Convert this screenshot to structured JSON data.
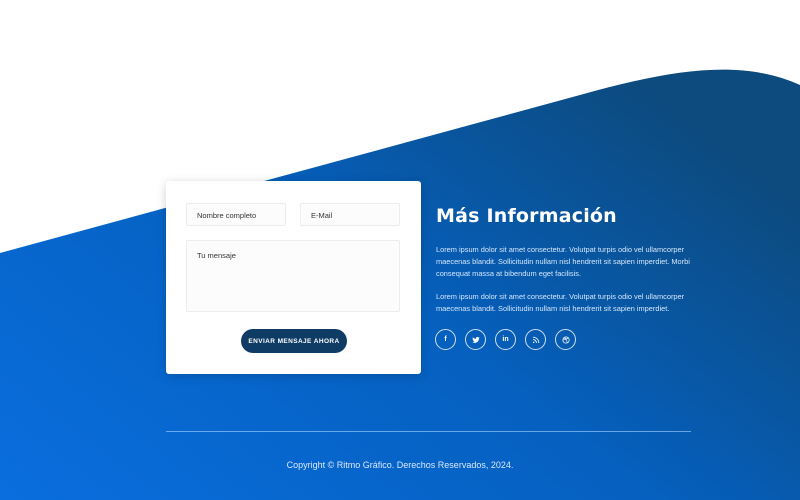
{
  "colors": {
    "gradient_start": "#0a6ede",
    "gradient_mid": "#0560bf",
    "gradient_end": "#0d4a7d",
    "button": "#0f3c65",
    "text_light": "#d6e8fb"
  },
  "contact_form": {
    "name_placeholder": "Nombre completo",
    "email_placeholder": "E-Mail",
    "message_placeholder": "Tu mensaje",
    "submit_label": "ENVIAR MENSAJE AHORA"
  },
  "info": {
    "title": "Más Información",
    "paragraph_1": "Lorem ipsum dolor sit amet consectetur. Volutpat turpis odio vel ullamcorper maecenas blandit. Sollicitudin nullam nisl hendrerit sit sapien imperdiet. Morbi consequat massa at bibendum eget facilisis.",
    "paragraph_2": "Lorem ipsum dolor sit amet consectetur. Volutpat turpis odio vel ullamcorper maecenas blandit. Sollicitudin nullam nisl hendrerit sit sapien imperdiet."
  },
  "socials": [
    {
      "icon": "facebook-icon",
      "glyph": "f"
    },
    {
      "icon": "twitter-icon",
      "glyph": ""
    },
    {
      "icon": "linkedin-icon",
      "glyph": "in"
    },
    {
      "icon": "rss-icon",
      "glyph": ""
    },
    {
      "icon": "dribbble-icon",
      "glyph": ""
    }
  ],
  "footer": {
    "copyright": "Copyright © Ritmo Gráfico. Derechos Reservados, 2024."
  }
}
